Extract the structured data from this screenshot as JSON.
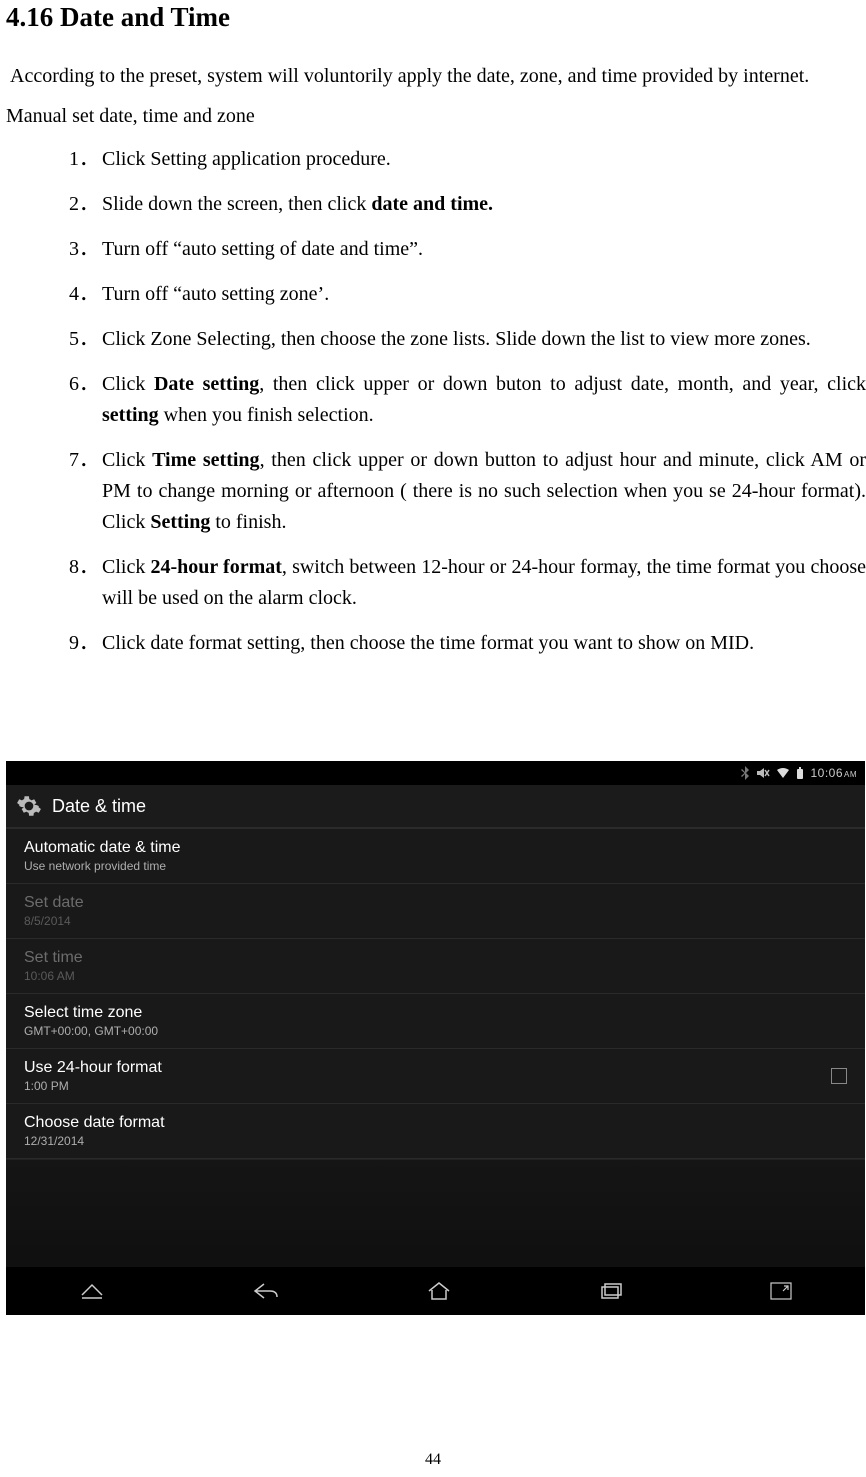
{
  "doc": {
    "section_title": "4.16 Date and Time",
    "intro": "According to the preset, system will voluntorily apply the date, zone, and time provided by internet.",
    "manual_heading": "Manual set date, time and zone",
    "steps": [
      {
        "n": "1．",
        "pre": "",
        "bold": "",
        "post": "Click Setting application procedure."
      },
      {
        "n": "2．",
        "pre": "Slide down the screen, then click ",
        "bold": "date and time.",
        "post": ""
      },
      {
        "n": "3．",
        "pre": "",
        "bold": "",
        "post": "Turn off “auto setting of date and time”."
      },
      {
        "n": "4．",
        "pre": "",
        "bold": "",
        "post": "Turn off “auto setting zone’."
      },
      {
        "n": "5．",
        "pre": "",
        "bold": "",
        "post": "Click Zone Selecting, then choose the zone lists. Slide down the list to view more zones."
      },
      {
        "n": "6．",
        "pre": "Click ",
        "bold": "Date setting",
        "post": ", then click upper or down buton to adjust date, month, and year, click ",
        "bold2": "setting",
        "post2": " when you finish selection."
      },
      {
        "n": "7．",
        "pre": "Click ",
        "bold": "Time setting",
        "post": ", then click upper or down button to adjust hour and minute, click AM or PM to change morning or afternoon ( there is no such selection when you se 24-hour format). Click ",
        "bold2": "Setting",
        "post2": " to finish."
      },
      {
        "n": "8．",
        "pre": "Click ",
        "bold": "24-hour format",
        "post": ", switch between 12-hour or 24-hour formay, the time format you choose will be used on the alarm clock."
      },
      {
        "n": "9．",
        "pre": "",
        "bold": "",
        "post": "Click date format setting, then choose the time format you want to show on MID."
      }
    ],
    "page_number": "44"
  },
  "shot": {
    "status": {
      "time": "10:06",
      "ampm": "AM"
    },
    "appbar_title": "Date & time",
    "rows": [
      {
        "primary": "Automatic date & time",
        "secondary": "Use network provided time",
        "disabled": false,
        "checkbox": false
      },
      {
        "primary": "Set date",
        "secondary": "8/5/2014",
        "disabled": true,
        "checkbox": false
      },
      {
        "primary": "Set time",
        "secondary": "10:06 AM",
        "disabled": true,
        "checkbox": false
      },
      {
        "primary": "Select time zone",
        "secondary": "GMT+00:00, GMT+00:00",
        "disabled": false,
        "checkbox": false
      },
      {
        "primary": "Use 24-hour format",
        "secondary": "1:00 PM",
        "disabled": false,
        "checkbox": true
      },
      {
        "primary": "Choose date format",
        "secondary": "12/31/2014",
        "disabled": false,
        "checkbox": false
      }
    ]
  }
}
